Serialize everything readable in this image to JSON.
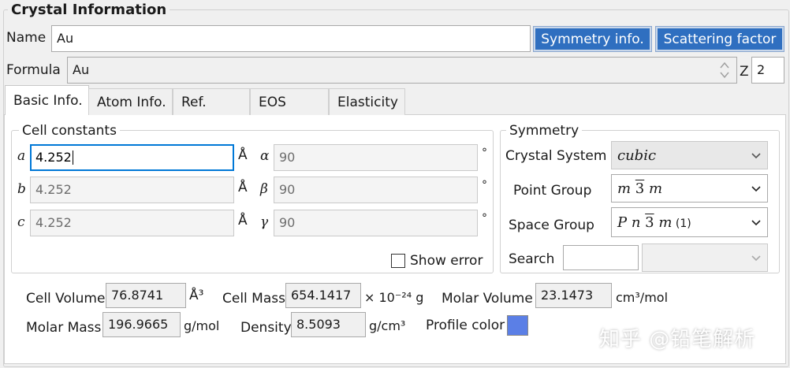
{
  "group_title": "Crystal Information",
  "name": {
    "label": "Name",
    "value": "Au"
  },
  "buttons": {
    "symmetry": "Symmetry info.",
    "scattering": "Scattering factor"
  },
  "formula": {
    "label": "Formula",
    "value": "Au"
  },
  "z": {
    "label": "Z",
    "value": "2"
  },
  "tabs": [
    {
      "label": "Basic Info.",
      "active": true
    },
    {
      "label": "Atom Info.",
      "active": false
    },
    {
      "label": "Ref.",
      "active": false
    },
    {
      "label": "EOS",
      "active": false
    },
    {
      "label": "Elasticity",
      "active": false
    }
  ],
  "cell_constants": {
    "title": "Cell constants",
    "a": {
      "label": "a",
      "value": "4.252",
      "unit": "Å"
    },
    "b": {
      "label": "b",
      "value": "4.252",
      "unit": "Å"
    },
    "c": {
      "label": "c",
      "value": "4.252",
      "unit": "Å"
    },
    "alpha": {
      "label": "α",
      "value": "90",
      "unit": "°"
    },
    "beta": {
      "label": "β",
      "value": "90",
      "unit": "°"
    },
    "gamma": {
      "label": "γ",
      "value": "90",
      "unit": "°"
    },
    "show_error": {
      "label": "Show error",
      "checked": false
    }
  },
  "symmetry": {
    "title": "Symmetry",
    "crystal_system": {
      "label": "Crystal System",
      "value": "cubic"
    },
    "point_group": {
      "label": "Point Group",
      "parts": [
        "m ",
        "3",
        " m"
      ]
    },
    "space_group": {
      "label": "Space Group",
      "parts": [
        "P n ",
        "3",
        " m"
      ],
      "setting": " (1)"
    },
    "search": {
      "label": "Search",
      "value": ""
    }
  },
  "properties": {
    "cell_volume": {
      "label": "Cell Volume",
      "value": "76.8741",
      "unit": "Å³"
    },
    "cell_mass": {
      "label": "Cell Mass",
      "value": "654.1417",
      "unit": "× 10⁻²⁴ g"
    },
    "molar_volume": {
      "label": "Molar Volume",
      "value": "23.1473",
      "unit": "cm³/mol"
    },
    "molar_mass": {
      "label": "Molar Mass",
      "value": "196.9665",
      "unit": "g/mol"
    },
    "density": {
      "label": "Density",
      "value": "8.5093",
      "unit": "g/cm³"
    },
    "profile_color": {
      "label": "Profile color",
      "color": "#5b7fe6"
    }
  },
  "watermark": "知乎 @铅笔解析",
  "colors": {
    "accent": "#2f6fc0",
    "focus": "#0078d7"
  }
}
